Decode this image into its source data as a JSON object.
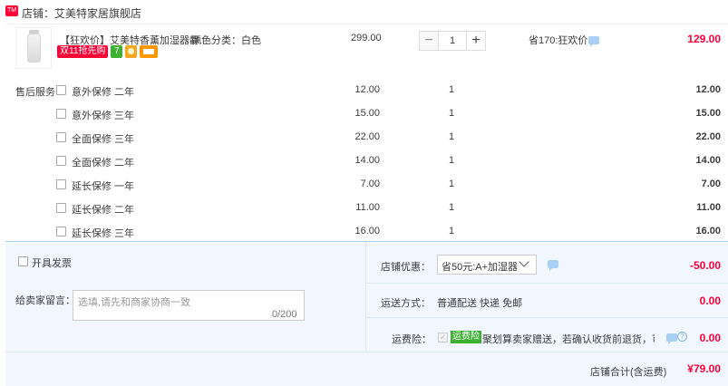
{
  "shop": {
    "logo_text": "TM",
    "name": "店铺：艾美特家居旗舰店"
  },
  "item": {
    "title": "【狂欢价】艾美特香薰加湿器静...",
    "tags": {
      "promo": "双11抢先购",
      "num": "7"
    },
    "color": "颜色分类：白色",
    "price": "299.00",
    "quantity": "1",
    "minus": "−",
    "plus": "+",
    "savings": "省170:狂欢价",
    "total": "129.00"
  },
  "service": {
    "label": "售后服务",
    "rows": [
      {
        "name": "意外保修 二年",
        "price": "12.00",
        "qty": "1",
        "total": "12.00"
      },
      {
        "name": "意外保修 三年",
        "price": "15.00",
        "qty": "1",
        "total": "15.00"
      },
      {
        "name": "全面保修 三年",
        "price": "22.00",
        "qty": "1",
        "total": "22.00"
      },
      {
        "name": "全面保修 二年",
        "price": "14.00",
        "qty": "1",
        "total": "14.00"
      },
      {
        "name": "延长保修 一年",
        "price": "7.00",
        "qty": "1",
        "total": "7.00"
      },
      {
        "name": "延长保修 二年",
        "price": "11.00",
        "qty": "1",
        "total": "11.00"
      },
      {
        "name": "延长保修 三年",
        "price": "16.00",
        "qty": "1",
        "total": "16.00"
      }
    ]
  },
  "footer": {
    "invoice_label": "开具发票",
    "message_label": "给卖家留言：",
    "message_placeholder": "选填,请先和商家协商一致",
    "message_count": "0/200",
    "coupon_label": "店铺优惠：",
    "coupon_value": "省50元:A+加湿器",
    "coupon_amount": "-50.00",
    "shipping_label": "运送方式：",
    "shipping_value": "普通配送 快递 免邮",
    "shipping_amount": "0.00",
    "insurance_label": "运费险：",
    "insurance_badge": "运费险",
    "insurance_text": "聚划算卖家赠送，若确认收货前退货，可获...",
    "insurance_amount": "0.00",
    "total_label": "店铺合计(含运费)",
    "total_value": "¥79.00"
  },
  "colors": {
    "accent": "#ff0036",
    "badge_green": "#3eb135",
    "footer_bg": "#f2f7ff"
  }
}
